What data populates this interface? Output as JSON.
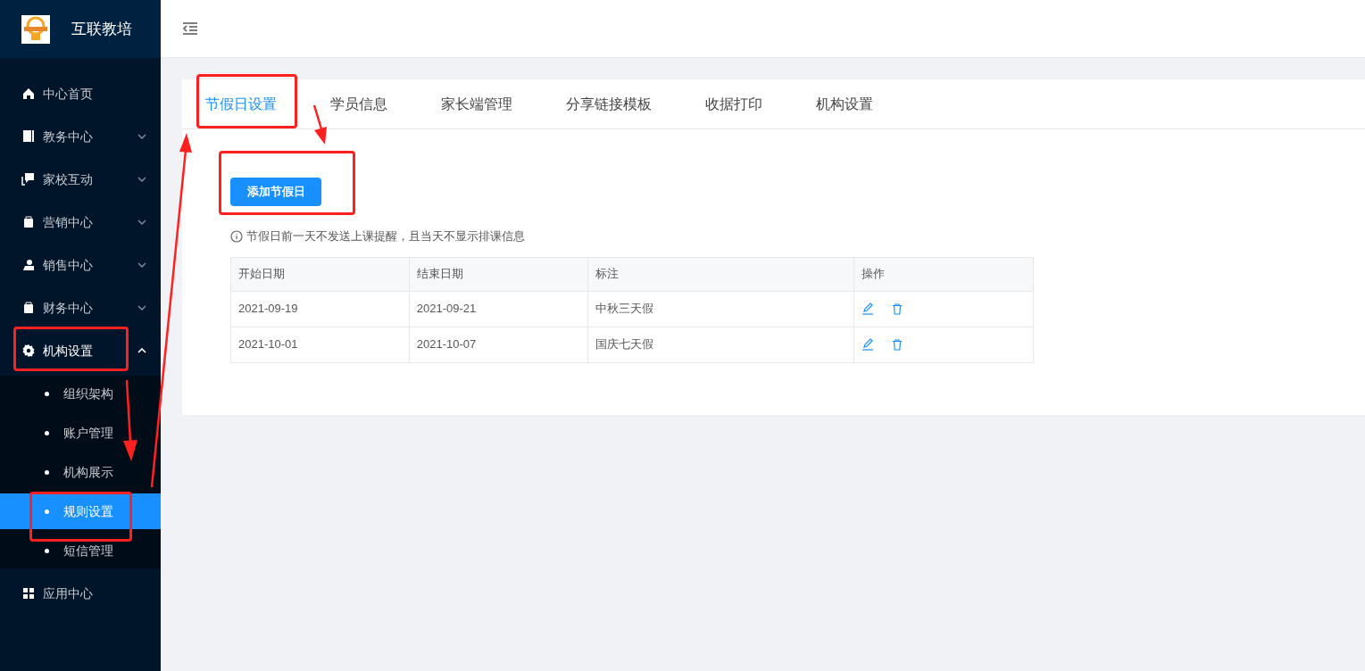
{
  "brand": {
    "title": "互联教培"
  },
  "sidebar": {
    "items": [
      {
        "label": "中心首页"
      },
      {
        "label": "教务中心",
        "expanded": false
      },
      {
        "label": "家校互动",
        "expanded": false
      },
      {
        "label": "营销中心",
        "expanded": false
      },
      {
        "label": "销售中心",
        "expanded": false
      },
      {
        "label": "财务中心",
        "expanded": false
      },
      {
        "label": "机构设置",
        "expanded": true,
        "children": [
          {
            "label": "组织架构",
            "selected": false
          },
          {
            "label": "账户管理",
            "selected": false
          },
          {
            "label": "机构展示",
            "selected": false
          },
          {
            "label": "规则设置",
            "selected": true
          },
          {
            "label": "短信管理",
            "selected": false
          }
        ]
      },
      {
        "label": "应用中心"
      }
    ]
  },
  "tabs": [
    {
      "label": "节假日设置",
      "selected": true
    },
    {
      "label": "学员信息",
      "selected": false
    },
    {
      "label": "家长端管理",
      "selected": false
    },
    {
      "label": "分享链接模板",
      "selected": false
    },
    {
      "label": "收据打印",
      "selected": false
    },
    {
      "label": "机构设置",
      "selected": false
    }
  ],
  "add_button": "添加节假日",
  "notice": "节假日前一天不发送上课提醒，且当天不显示排课信息",
  "table": {
    "columns": [
      "开始日期",
      "结束日期",
      "标注",
      "操作"
    ],
    "rows": [
      [
        "2021-09-19",
        "2021-09-21",
        "中秋三天假"
      ],
      [
        "2021-10-01",
        "2021-10-07",
        "国庆七天假"
      ]
    ]
  }
}
